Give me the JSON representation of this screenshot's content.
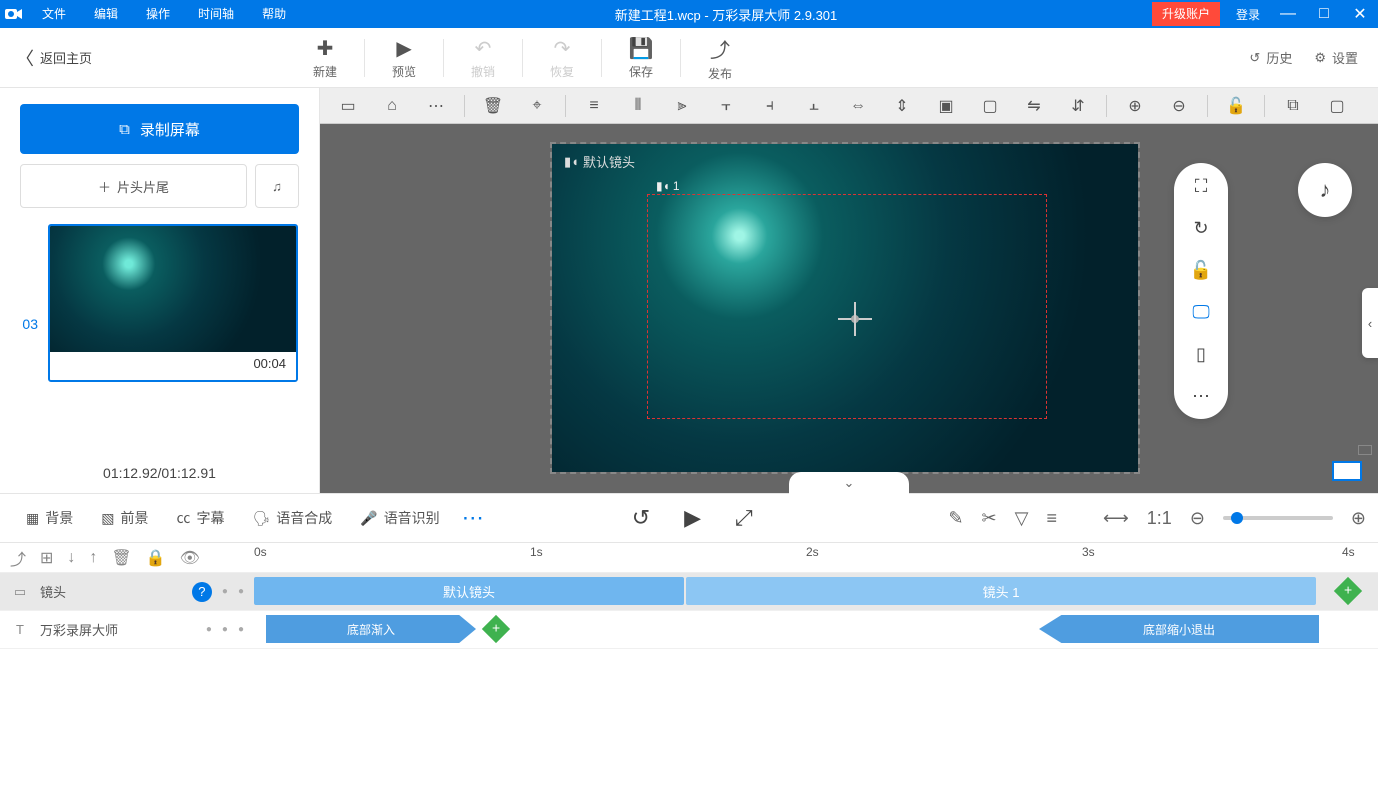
{
  "titlebar": {
    "menus": [
      "文件",
      "编辑",
      "操作",
      "时间轴",
      "帮助"
    ],
    "title": "新建工程1.wcp - 万彩录屏大师 2.9.301",
    "upgrade": "升级账户",
    "login": "登录"
  },
  "maintool": {
    "back": "返回主页",
    "buttons": [
      {
        "label": "新建",
        "icon": "＋"
      },
      {
        "label": "预览",
        "icon": "▶"
      },
      {
        "label": "撤销",
        "icon": "↶",
        "disabled": true
      },
      {
        "label": "恢复",
        "icon": "↷",
        "disabled": true
      },
      {
        "label": "保存",
        "icon": "💾"
      },
      {
        "label": "发布",
        "icon": "⤴"
      }
    ],
    "history": "历史",
    "settings": "设置"
  },
  "sidebar": {
    "record": "录制屏幕",
    "headtail": "片头片尾",
    "clip_num": "03",
    "clip_duration": "00:04",
    "time_info": "01:12.92/01:12.91"
  },
  "canvas": {
    "default_cam": "默认镜头",
    "inner_cam": "1"
  },
  "panel": {
    "tabs": [
      "背景",
      "前景",
      "字幕",
      "语音合成",
      "语音识别"
    ]
  },
  "timeline": {
    "ticks": [
      "0s",
      "1s",
      "2s",
      "3s",
      "4s"
    ],
    "camera_row": "镜头",
    "text_row": "万彩录屏大师",
    "clip_default": "默认镜头",
    "clip_cam1": "镜头 1",
    "text_in": "底部渐入",
    "text_out": "底部缩小退出"
  }
}
